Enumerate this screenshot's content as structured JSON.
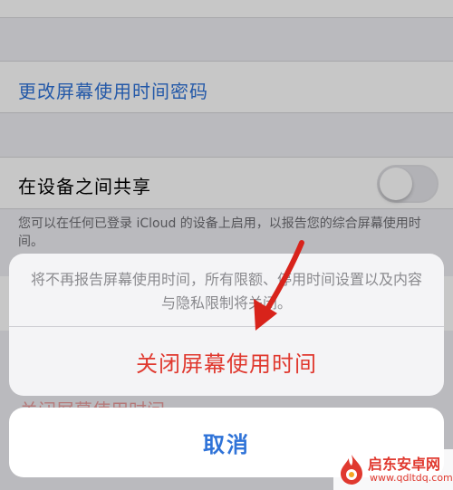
{
  "background": {
    "passcode_label": "更改屏幕使用时间密码",
    "share_label": "在设备之间共享",
    "share_toggle_on": false,
    "share_footer": "您可以在任何已登录 iCloud 的设备上启用，以报告您的综合屏幕使用时间。",
    "turnoff_ghost_label": "关闭屏幕使用时间"
  },
  "action_sheet": {
    "message": "将不再报告屏幕使用时间，所有限额、停用时间设置以及内容与隐私限制将关闭。",
    "destructive_label": "关闭屏幕使用时间",
    "cancel_label": "取消"
  },
  "watermark": {
    "name": "启东安卓网",
    "url": "www.qdltdq.com"
  },
  "colors": {
    "link_blue": "#2f73d8",
    "destructive_red": "#e0392f",
    "arrow_red": "#d8231b"
  }
}
